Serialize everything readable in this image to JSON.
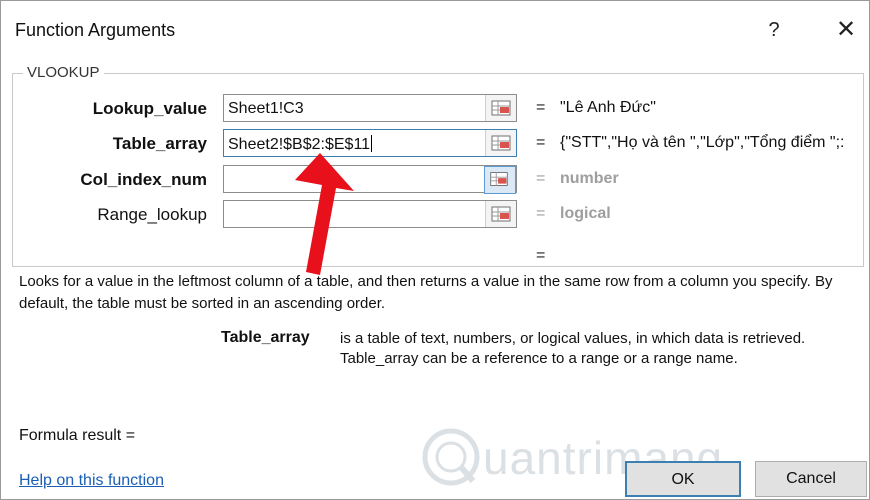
{
  "window": {
    "title": "Function Arguments",
    "help_glyph": "?",
    "close_glyph": "✕"
  },
  "group": {
    "label": "VLOOKUP"
  },
  "args": [
    {
      "label": "Lookup_value",
      "value": "Sheet1!C3",
      "result": "\"Lê Anh Đức\"",
      "eq": "="
    },
    {
      "label": "Table_array",
      "value": "Sheet2!$B$2:$E$11",
      "result": "{\"STT\",\"Họ và tên \",\"Lớp\",\"Tổng điểm \";:",
      "eq": "="
    },
    {
      "label": "Col_index_num",
      "value": "",
      "result": "number",
      "eq": "="
    },
    {
      "label": "Range_lookup",
      "value": "",
      "result": "logical",
      "eq": "="
    }
  ],
  "overall_eq": "=",
  "description": "Looks for a value in the leftmost column of a table, and then returns a value in the same row from a column you specify. By default, the table must be sorted in an ascending order.",
  "arg_help": {
    "name": "Table_array",
    "text": "is a table of text, numbers, or logical values, in which data is retrieved. Table_array can be a reference to a range or a range name."
  },
  "formula_result": "Formula result =",
  "help_link": "Help on this function",
  "buttons": {
    "ok": "OK",
    "cancel": "Cancel"
  },
  "watermark": "uantrimang",
  "colors": {
    "arrow": "#e8101a",
    "link": "#1a5fb4",
    "hint": "#9e9e9e",
    "focus": "#3c7fb1"
  },
  "icons": {
    "ref": "range-selector-icon",
    "arrow": "red-arrow-annotation"
  }
}
